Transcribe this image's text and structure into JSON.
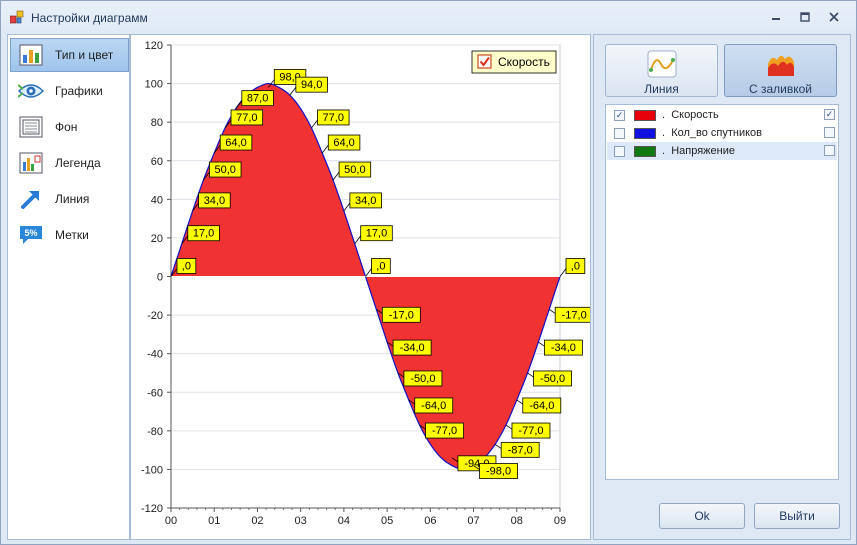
{
  "window": {
    "title": "Настройки диаграмм"
  },
  "nav": [
    {
      "label": "Тип и цвет",
      "icon": "bar-chart-icon",
      "active": true
    },
    {
      "label": "Графики",
      "icon": "eye-icon",
      "active": false
    },
    {
      "label": "Фон",
      "icon": "background-icon",
      "active": false
    },
    {
      "label": "Легенда",
      "icon": "legend-icon",
      "active": false
    },
    {
      "label": "Линия",
      "icon": "arrow-up-right-icon",
      "active": false
    },
    {
      "label": "Метки",
      "icon": "percent-tag-icon",
      "active": false
    }
  ],
  "modes": [
    {
      "label": "Линия",
      "icon": "line-chart-icon",
      "active": false
    },
    {
      "label": "С заливкой",
      "icon": "area-chart-icon",
      "active": true
    }
  ],
  "series_list": [
    {
      "name": "Скорость",
      "color": "#e8000b",
      "checked_left": true,
      "checked_right": true,
      "selected": false
    },
    {
      "name": "Кол_во спутников",
      "color": "#1010e0",
      "checked_left": false,
      "checked_right": false,
      "selected": false
    },
    {
      "name": "Напряжение",
      "color": "#107a10",
      "checked_left": false,
      "checked_right": false,
      "selected": true
    }
  ],
  "series_prefix": ".",
  "buttons": {
    "ok": "Ok",
    "exit": "Выйти"
  },
  "chart_data": {
    "type": "area",
    "x": [
      0,
      0.25,
      0.5,
      0.75,
      1,
      1.25,
      1.5,
      1.75,
      2,
      2.25,
      2.5,
      2.75,
      3,
      3.25,
      3.5,
      3.75,
      4,
      4.25,
      4.5,
      4.75,
      5,
      5.25,
      5.5,
      5.75,
      6,
      6.25,
      6.5,
      6.75,
      7,
      7.25,
      7.5,
      7.75,
      8,
      8.25,
      8.5,
      8.75,
      9
    ],
    "series": [
      {
        "name": "Скорость",
        "values": [
          0,
          17,
          34,
          50,
          64,
          77,
          87,
          94,
          98,
          100,
          98,
          94,
          87,
          77,
          64,
          50,
          34,
          17,
          0,
          -17,
          -34,
          -50,
          -64,
          -77,
          -87,
          -94,
          -98,
          -100,
          -98,
          -94,
          -87,
          -77,
          -64,
          -50,
          -34,
          -17,
          0
        ],
        "fill": "#f03232",
        "line": "#1010c8"
      }
    ],
    "labels": [
      {
        "x": 0,
        "y": 0,
        "text": ",0"
      },
      {
        "x": 0.25,
        "y": 17,
        "text": "17,0"
      },
      {
        "x": 0.5,
        "y": 34,
        "text": "34,0"
      },
      {
        "x": 0.75,
        "y": 50,
        "text": "50,0"
      },
      {
        "x": 1,
        "y": 64,
        "text": "64,0"
      },
      {
        "x": 1.25,
        "y": 77,
        "text": "77,0"
      },
      {
        "x": 1.5,
        "y": 87,
        "text": "87,0"
      },
      {
        "x": 2.25,
        "y": 98,
        "text": "98,0"
      },
      {
        "x": 2.75,
        "y": 94,
        "text": "94,0"
      },
      {
        "x": 3.25,
        "y": 77,
        "text": "77,0"
      },
      {
        "x": 3.5,
        "y": 64,
        "text": "64,0"
      },
      {
        "x": 3.75,
        "y": 50,
        "text": "50,0"
      },
      {
        "x": 4,
        "y": 34,
        "text": "34,0"
      },
      {
        "x": 4.25,
        "y": 17,
        "text": "17,0"
      },
      {
        "x": 4.5,
        "y": 0,
        "text": ",0"
      },
      {
        "x": 4.75,
        "y": -17,
        "text": "-17,0"
      },
      {
        "x": 5,
        "y": -34,
        "text": "-34,0"
      },
      {
        "x": 5.25,
        "y": -50,
        "text": "-50,0"
      },
      {
        "x": 5.5,
        "y": -64,
        "text": "-64,0"
      },
      {
        "x": 5.75,
        "y": -77,
        "text": "-77,0"
      },
      {
        "x": 6.5,
        "y": -94,
        "text": "-94,0"
      },
      {
        "x": 7,
        "y": -98,
        "text": "-98,0"
      },
      {
        "x": 7.5,
        "y": -87,
        "text": "-87,0"
      },
      {
        "x": 7.75,
        "y": -77,
        "text": "-77,0"
      },
      {
        "x": 8,
        "y": -64,
        "text": "-64,0"
      },
      {
        "x": 8.25,
        "y": -50,
        "text": "-50,0"
      },
      {
        "x": 8.5,
        "y": -34,
        "text": "-34,0"
      },
      {
        "x": 8.75,
        "y": -17,
        "text": "-17,0"
      },
      {
        "x": 9,
        "y": 0,
        "text": ",0"
      }
    ],
    "xticks": [
      "00",
      "01",
      "02",
      "03",
      "04",
      "05",
      "06",
      "07",
      "08",
      "09"
    ],
    "yticks": [
      120,
      100,
      80,
      60,
      40,
      20,
      0,
      -20,
      -40,
      -60,
      -80,
      -100,
      -120
    ],
    "xlim": [
      0,
      9
    ],
    "ylim": [
      -120,
      120
    ],
    "grid": true,
    "legend": {
      "placement": "top-right",
      "label": "Скорость",
      "checked": true
    },
    "label_style": {
      "background": "#ffff00",
      "border": "#000000"
    }
  }
}
